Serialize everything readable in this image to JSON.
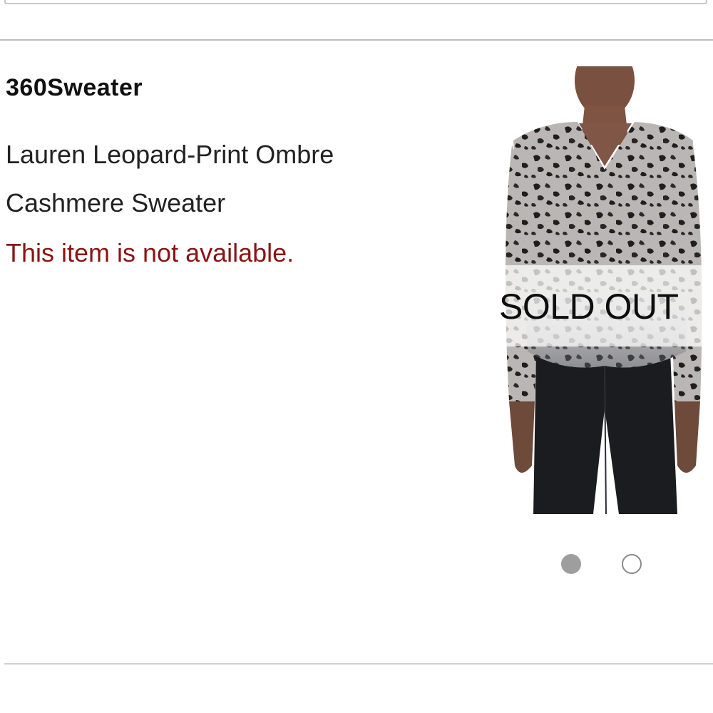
{
  "product": {
    "brand": "360Sweater",
    "name_line1": "Lauren Leopard-Print Ombre",
    "name_line2": "Cashmere Sweater",
    "availability": "This item is not available.",
    "status_overlay": "SOLD OUT"
  },
  "carousel": {
    "slide_count": 2,
    "active_index": 0
  },
  "colors": {
    "availability_text": "#8b1414",
    "divider": "#bdbdbd",
    "dot_active": "#9e9e9e"
  }
}
